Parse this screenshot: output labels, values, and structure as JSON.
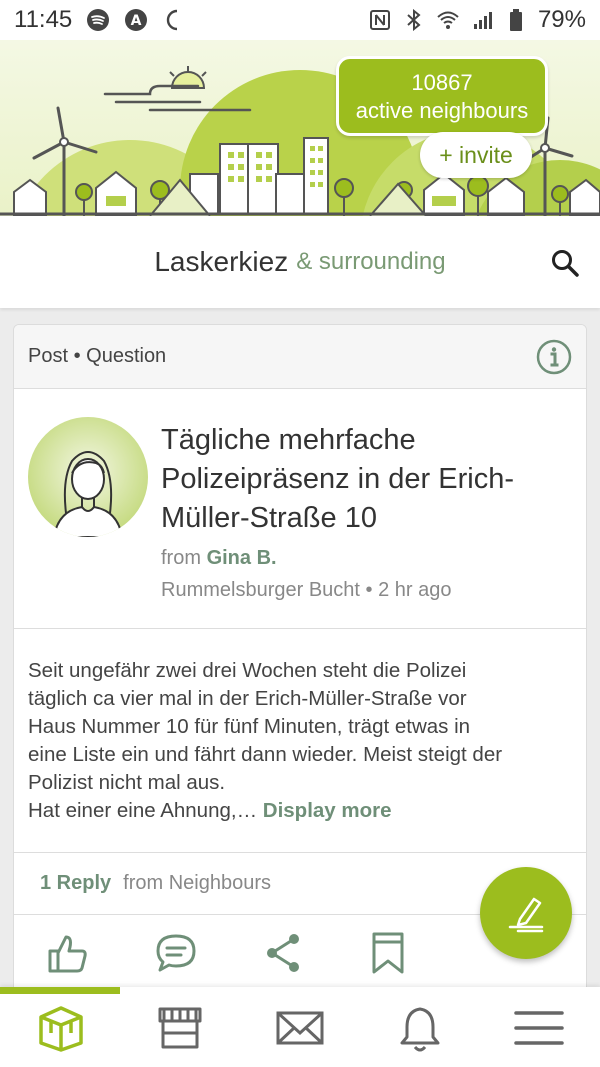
{
  "status_bar": {
    "time": "11:45",
    "battery": "79%"
  },
  "banner": {
    "count": "10867",
    "count_label": "active neighbours",
    "invite_label": "+ invite"
  },
  "header": {
    "title": "Laskerkiez",
    "subtitle": "& surrounding"
  },
  "post": {
    "type_label": "Post • Question",
    "title": "Tägliche mehrfache Polizeipräsenz in der Erich-Müller-Straße 10",
    "from_prefix": "from",
    "author": "Gina B.",
    "meta": "Rummelsburger Bucht • 2 hr ago",
    "body_lines": [
      "Seit ungefähr zwei drei Wochen steht  die Polizei",
      "täglich ca vier mal in der Erich-Müller-Straße vor",
      "Haus Nummer 10 für fünf Minuten, trägt etwas in",
      "eine Liste ein und fährt dann wieder. Meist steigt der",
      "Polizist nicht mal aus."
    ],
    "body_last": "Hat einer eine Ahnung,…",
    "display_more": "Display more",
    "reply_count": "1 Reply",
    "reply_from": "from Neighbours"
  },
  "colors": {
    "brand_green": "#9cbd1e",
    "muted_green": "#6f8f78"
  },
  "icons": {
    "actions": [
      "thumbs-up-icon",
      "comment-icon",
      "share-icon",
      "bookmark-icon"
    ],
    "nav": [
      "home-icon",
      "marketplace-icon",
      "mail-icon",
      "bell-icon",
      "menu-icon"
    ]
  }
}
